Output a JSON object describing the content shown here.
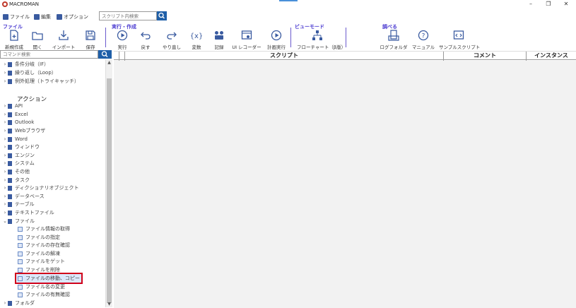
{
  "window": {
    "title": "MACROMAN",
    "minimize": "–",
    "restore": "❐",
    "close": "✕"
  },
  "menu": [
    {
      "label": "ファイル"
    },
    {
      "label": "編集"
    },
    {
      "label": "オプション"
    }
  ],
  "top_search": {
    "placeholder": "スクリプト内検索"
  },
  "ribbon": {
    "groups": [
      {
        "label": "ファイル"
      },
      {
        "label": "実行・作成"
      },
      {
        "label": "ビューモード"
      },
      {
        "label": "調べる"
      }
    ],
    "buttons": [
      {
        "label": "新規作成",
        "icon": "new-file-icon"
      },
      {
        "label": "開く",
        "icon": "open-folder-icon"
      },
      {
        "label": "インポート",
        "icon": "import-icon"
      },
      {
        "label": "保存",
        "icon": "save-icon"
      },
      {
        "label": "実行",
        "icon": "play-icon"
      },
      {
        "label": "戻す",
        "icon": "undo-icon"
      },
      {
        "label": "やり直し",
        "icon": "redo-icon"
      },
      {
        "label": "変数",
        "icon": "variable-icon"
      },
      {
        "label": "記録",
        "icon": "record-icon"
      },
      {
        "label": "UI レコーダー",
        "icon": "ui-recorder-icon"
      },
      {
        "label": "計画実行",
        "icon": "schedule-icon"
      },
      {
        "label": "フローチャート（β版）",
        "icon": "flowchart-icon"
      },
      {
        "label": "ログフォルダ",
        "icon": "log-folder-icon"
      },
      {
        "label": "マニュアル",
        "icon": "help-icon"
      },
      {
        "label": "サンプルスクリプト",
        "icon": "sample-script-icon"
      }
    ]
  },
  "command_search": {
    "placeholder": "コマンド検索"
  },
  "tree": {
    "control_items": [
      {
        "label": "条件分岐（IF）"
      },
      {
        "label": "繰り返し（Loop）"
      },
      {
        "label": "例外処理（トライキャッチ）"
      }
    ],
    "section_label": "アクション",
    "action_items": [
      {
        "label": "API"
      },
      {
        "label": "Excel"
      },
      {
        "label": "Outlook"
      },
      {
        "label": "Webブラウザ"
      },
      {
        "label": "Word"
      },
      {
        "label": "ウィンドウ"
      },
      {
        "label": "エンジン"
      },
      {
        "label": "システム"
      },
      {
        "label": "その他"
      },
      {
        "label": "タスク"
      },
      {
        "label": "ディクショナリオブジェクト"
      },
      {
        "label": "データベース"
      },
      {
        "label": "テーブル"
      },
      {
        "label": "テキストファイル"
      },
      {
        "label": "ファイル"
      }
    ],
    "file_children": [
      {
        "label": "ファイル情報の取得"
      },
      {
        "label": "ファイルの指定"
      },
      {
        "label": "ファイルの存在確認"
      },
      {
        "label": "ファイルの解凍"
      },
      {
        "label": "ファイルをゲット"
      },
      {
        "label": "ファイルを削除"
      },
      {
        "label": "ファイルの移動、コピー"
      },
      {
        "label": "ファイル名の変更"
      },
      {
        "label": "ファイルの有無確認"
      }
    ],
    "last_item": {
      "label": "フォルダ"
    }
  },
  "grid": {
    "columns": [
      {
        "label": "スクリプト"
      },
      {
        "label": "コメント"
      },
      {
        "label": "インスタンス"
      }
    ]
  },
  "colors": {
    "accent": "#1f5fa8",
    "group_label": "#4b3bd1",
    "selection_outline": "#d0021b"
  }
}
